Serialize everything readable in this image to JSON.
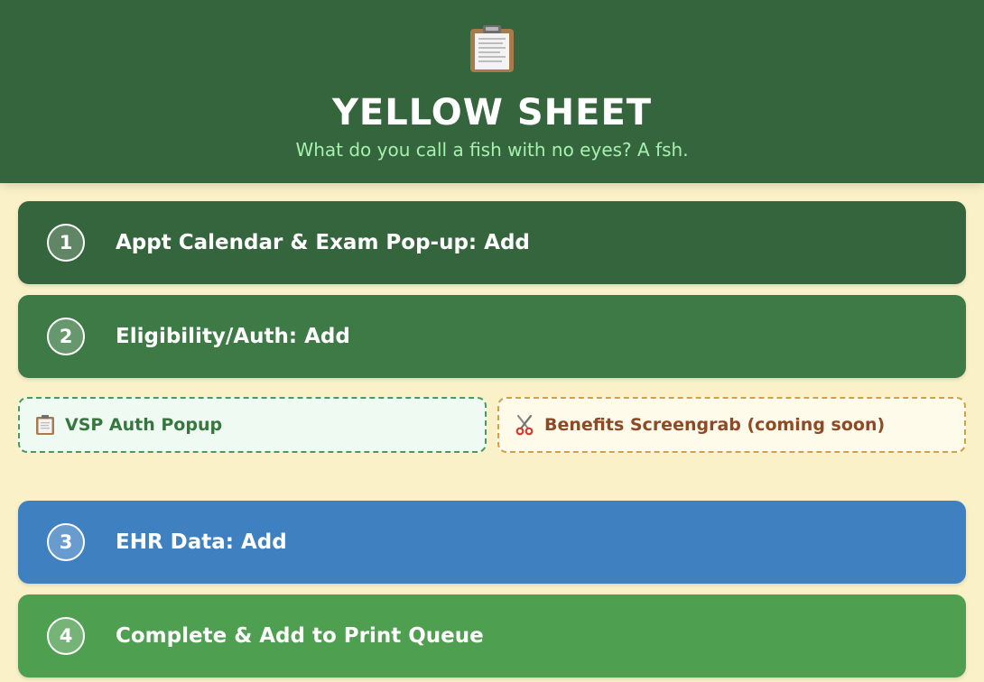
{
  "header": {
    "icon": "clipboard-icon",
    "title": "YELLOW SHEET",
    "subtitle": "What do you call a fish with no eyes? A fsh."
  },
  "steps": [
    {
      "number": "1",
      "label": "Appt Calendar & Exam Pop-up: Add",
      "color": "#35653c"
    },
    {
      "number": "2",
      "label": "Eligibility/Auth: Add",
      "color": "#3d7a45"
    },
    {
      "number": "3",
      "label": "EHR Data: Add",
      "color": "#3e80c0"
    },
    {
      "number": "4",
      "label": "Complete & Add to Print Queue",
      "color": "#4f9f50"
    }
  ],
  "tools": {
    "vsp": {
      "icon": "clipboard-icon",
      "label": "VSP Auth Popup"
    },
    "benefits": {
      "icon": "scissors-icon",
      "label": "Benefits Screengrab (coming soon)"
    }
  },
  "colors": {
    "page_background": "#fbf1c9",
    "header_background": "#35653c",
    "subtitle": "#a6f0b0"
  }
}
